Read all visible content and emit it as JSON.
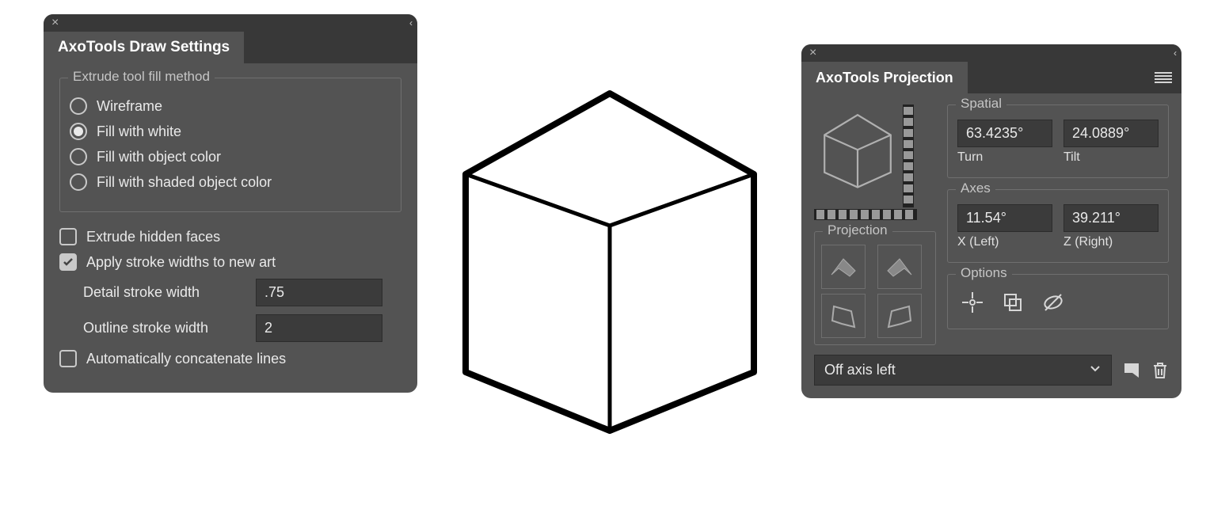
{
  "panel1": {
    "title": "AxoTools Draw Settings",
    "fill_legend": "Extrude tool fill method",
    "radios": {
      "wireframe": "Wireframe",
      "fill_white": "Fill with white",
      "fill_obj": "Fill with object color",
      "fill_shaded": "Fill with shaded object color"
    },
    "checks": {
      "hidden": "Extrude hidden faces",
      "apply_stroke": "Apply stroke widths to new art",
      "concat": "Automatically concatenate lines"
    },
    "detail_label": "Detail stroke width",
    "detail_value": ".75",
    "outline_label": "Outline stroke width",
    "outline_value": "2"
  },
  "panel2": {
    "title": "AxoTools Projection",
    "spatial_legend": "Spatial",
    "turn_value": "63.4235°",
    "turn_label": "Turn",
    "tilt_value": "24.0889°",
    "tilt_label": "Tilt",
    "axes_legend": "Axes",
    "x_value": "11.54°",
    "x_label": "X (Left)",
    "z_value": "39.211°",
    "z_label": "Z (Right)",
    "projection_legend": "Projection",
    "options_legend": "Options",
    "dropdown_value": "Off axis left"
  }
}
